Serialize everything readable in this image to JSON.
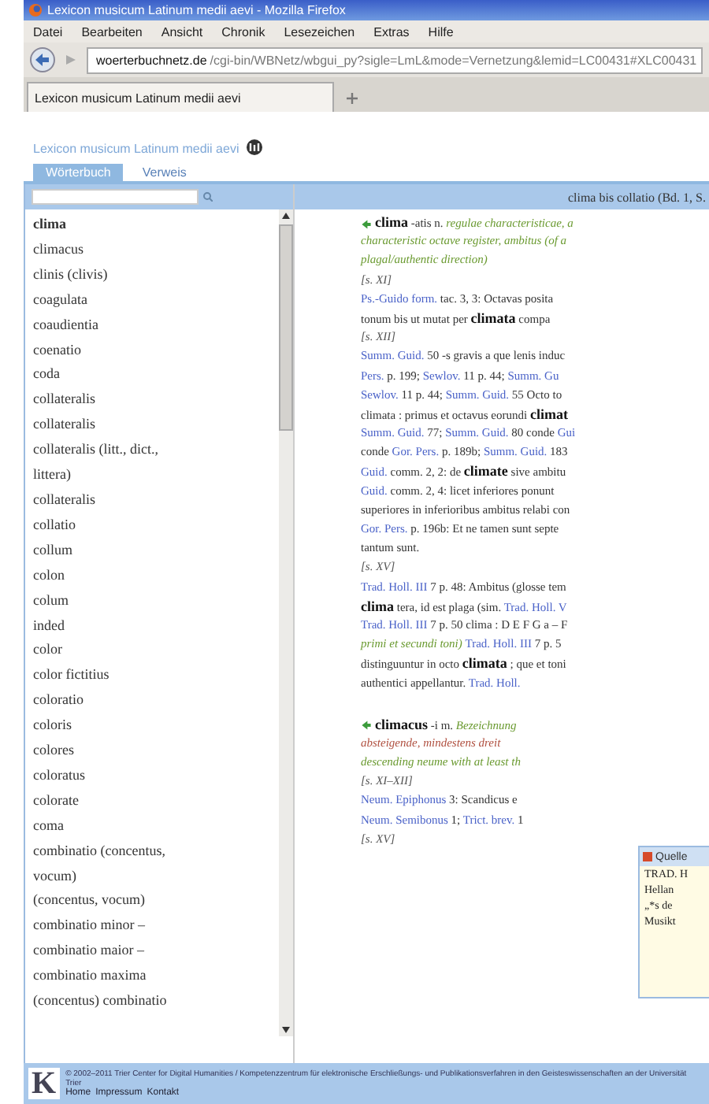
{
  "window": {
    "title": "Lexicon musicum Latinum medii aevi - Mozilla Firefox"
  },
  "menu": [
    "Datei",
    "Bearbeiten",
    "Ansicht",
    "Chronik",
    "Lesezeichen",
    "Extras",
    "Hilfe"
  ],
  "address": {
    "host": "woerterbuchnetz.de",
    "path": "/cgi-bin/WBNetz/wbgui_py?sigle=LmL&mode=Vernetzung&lemid=LC00431#XLC00431"
  },
  "browser_tabs": [
    {
      "label": "Lexicon musicum Latinum medii aevi",
      "selected": true
    }
  ],
  "site": {
    "title": "Lexicon musicum Latinum medii aevi"
  },
  "tabs": [
    {
      "label": "Wörterbuch",
      "selected": true
    },
    {
      "label": "Verweis",
      "selected": false
    }
  ],
  "range": "clima bis collatio (Bd. 1, S.",
  "lemmas": [
    {
      "text": "clima",
      "selected": true
    },
    {
      "text": "climacus",
      "selected": false
    },
    {
      "text": "clinis (clivis)",
      "selected": false
    },
    {
      "text": "coagulata",
      "selected": false
    },
    {
      "text": "coaudientia",
      "selected": false
    },
    {
      "text": "coenatio",
      "selected": false
    },
    {
      "text": "coda",
      "selected": false
    },
    {
      "text": "collateralis",
      "selected": false
    },
    {
      "text": "collateralis",
      "selected": false
    },
    {
      "text": "collateralis (litt., dict.,",
      "selected": false
    },
    {
      "text": "littera)",
      "selected": false
    },
    {
      "text": "collateralis",
      "selected": false
    },
    {
      "text": "collatio",
      "selected": false
    },
    {
      "text": "collum",
      "selected": false
    },
    {
      "text": "colon",
      "selected": false
    },
    {
      "text": "colum",
      "selected": false
    },
    {
      "text": "inded",
      "selected": false
    },
    {
      "text": "color",
      "selected": false
    },
    {
      "text": "color fictitius",
      "selected": false
    },
    {
      "text": "coloratio",
      "selected": false
    },
    {
      "text": "coloris",
      "selected": false
    },
    {
      "text": "colores",
      "selected": false
    },
    {
      "text": "coloratus",
      "selected": false
    },
    {
      "text": "colorate",
      "selected": false
    },
    {
      "text": "coma",
      "selected": false
    },
    {
      "text": "combinatio (concentus,",
      "selected": false
    },
    {
      "text": "vocum)",
      "selected": false
    },
    {
      "text": "(concentus, vocum)",
      "selected": false
    },
    {
      "text": "combinatio minor –",
      "selected": false
    },
    {
      "text": "combinatio maior –",
      "selected": false
    },
    {
      "text": "combinatio maxima",
      "selected": false
    },
    {
      "text": "(concentus) combinatio",
      "selected": false
    }
  ],
  "entries": [
    [
      [
        {
          "kind": "icon"
        },
        {
          "kind": "head",
          "text": "clima"
        },
        {
          "kind": "text",
          "text": " -atis n. "
        },
        {
          "kind": "gloss",
          "text": "regulae characteristicae, a"
        }
      ],
      [
        {
          "kind": "gloss",
          "text": "characteristic octave register, ambitus (of a"
        }
      ],
      [
        {
          "kind": "gloss",
          "text": "plagal/authentic direction)"
        }
      ],
      [
        {
          "kind": "section",
          "text": "[s. XI]"
        }
      ],
      [
        {
          "kind": "source",
          "text": "Ps.-Guido form."
        },
        {
          "kind": "text",
          "text": " tac. 3, 3: Octavas posita"
        }
      ],
      [
        {
          "kind": "text",
          "text": "tonum bis ut mutat per "
        },
        {
          "kind": "head",
          "text": "climata"
        },
        {
          "kind": "text",
          "text": " compa"
        }
      ],
      [
        {
          "kind": "section",
          "text": "[s. XII]"
        }
      ],
      [
        {
          "kind": "source",
          "text": "Summ. Guid."
        },
        {
          "kind": "text",
          "text": " 50 -s gravis a que lenis induc"
        }
      ],
      [
        {
          "kind": "source",
          "text": "Pers."
        },
        {
          "kind": "text",
          "text": " p. 199; "
        },
        {
          "kind": "source",
          "text": "Sewlov."
        },
        {
          "kind": "text",
          "text": " 11 p. 44; "
        },
        {
          "kind": "source",
          "text": "Summ. Gu"
        }
      ],
      [
        {
          "kind": "source",
          "text": "Sewlov."
        },
        {
          "kind": "text",
          "text": " 11 p. 44; "
        },
        {
          "kind": "source",
          "text": "Summ. Guid."
        },
        {
          "kind": "text",
          "text": " 55 Octo to"
        }
      ],
      [
        {
          "kind": "text",
          "text": "climata : primus et octavus eorundi "
        },
        {
          "kind": "head",
          "text": "climat"
        }
      ],
      [
        {
          "kind": "source",
          "text": "Summ. Guid."
        },
        {
          "kind": "text",
          "text": " 77; "
        },
        {
          "kind": "source",
          "text": "Summ. Guid."
        },
        {
          "kind": "text",
          "text": " 80 conde "
        },
        {
          "kind": "source",
          "text": "Gui"
        }
      ],
      [
        {
          "kind": "text",
          "text": "conde "
        },
        {
          "kind": "source",
          "text": "Gor. Pers."
        },
        {
          "kind": "text",
          "text": " p. 189b; "
        },
        {
          "kind": "source",
          "text": "Summ. Guid."
        },
        {
          "kind": "text",
          "text": " 183"
        }
      ],
      [
        {
          "kind": "source",
          "text": "Guid."
        },
        {
          "kind": "text",
          "text": " comm. 2, 2: de "
        },
        {
          "kind": "head",
          "text": "climate"
        },
        {
          "kind": "text",
          "text": " sive ambitu"
        }
      ],
      [
        {
          "kind": "source",
          "text": "Guid."
        },
        {
          "kind": "text",
          "text": " comm. 2, 4: licet inferiores ponunt"
        }
      ],
      [
        {
          "kind": "text",
          "text": "superiores in inferioribus ambitus relabi con"
        }
      ],
      [
        {
          "kind": "source",
          "text": "Gor. Pers."
        },
        {
          "kind": "text",
          "text": " p. 196b: Et ne tamen sunt septe"
        }
      ],
      [
        {
          "kind": "text",
          "text": "tantum sunt."
        }
      ],
      [
        {
          "kind": "section",
          "text": "[s. XV]"
        }
      ],
      [
        {
          "kind": "source",
          "text": "Trad. Holl. III"
        },
        {
          "kind": "text",
          "text": " 7 p. 48: Ambitus (glosse tem"
        }
      ],
      [
        {
          "kind": "head",
          "text": "clima"
        },
        {
          "kind": "text",
          "text": " tera, id est plaga (sim. "
        },
        {
          "kind": "source",
          "text": "Trad. Holl. V"
        }
      ],
      [
        {
          "kind": "source",
          "text": "Trad. Holl. III"
        },
        {
          "kind": "text",
          "text": " 7 p. 50 clima : D E F G a – F"
        }
      ],
      [
        {
          "kind": "gloss",
          "text": "primi et secundi toni) "
        },
        {
          "kind": "source",
          "text": "Trad. Holl. III"
        },
        {
          "kind": "text",
          "text": " 7 p. 5"
        }
      ],
      [
        {
          "kind": "text",
          "text": "distinguuntur in octo "
        },
        {
          "kind": "head",
          "text": "climata"
        },
        {
          "kind": "text",
          "text": " ; que et toni"
        }
      ],
      [
        {
          "kind": "text",
          "text": "authentici appellantur. "
        },
        {
          "kind": "source",
          "text": "Trad. Holl."
        }
      ]
    ],
    [
      [
        {
          "kind": "icon"
        },
        {
          "kind": "head",
          "text": "climacus"
        },
        {
          "kind": "text",
          "text": " -i m. "
        },
        {
          "kind": "gloss",
          "text": "Bezeichnung"
        }
      ],
      [
        {
          "kind": "note",
          "text": "absteigende, mindestens dreit"
        }
      ],
      [
        {
          "kind": "gloss",
          "text": "descending neume with at least th"
        }
      ],
      [
        {
          "kind": "section",
          "text": "[s. XI–XII]"
        }
      ],
      [
        {
          "kind": "source",
          "text": "Neum. Epiphonus"
        },
        {
          "kind": "text",
          "text": " 3: Scandicus e"
        }
      ],
      [
        {
          "kind": "source",
          "text": "Neum. Semibonus"
        },
        {
          "kind": "text",
          "text": " 1; "
        },
        {
          "kind": "source",
          "text": "Trict. brev."
        },
        {
          "kind": "text",
          "text": " 1"
        }
      ],
      [
        {
          "kind": "section",
          "text": "[s. XV]"
        }
      ]
    ]
  ],
  "popup": {
    "title": "Quelle",
    "lines": [
      "TRAD. H",
      "Hellan",
      "„*s de",
      "Musikt"
    ]
  },
  "footer": {
    "logo": "K",
    "text": "© 2002–2011 Trier Center for Digital Humanities / Kompetenzzentrum für elektronische Erschließungs- und Publikationsverfahren in den Geisteswissenschaften an der Universität Trier",
    "links": [
      "Home",
      "Impressum",
      "Kontakt"
    ]
  }
}
